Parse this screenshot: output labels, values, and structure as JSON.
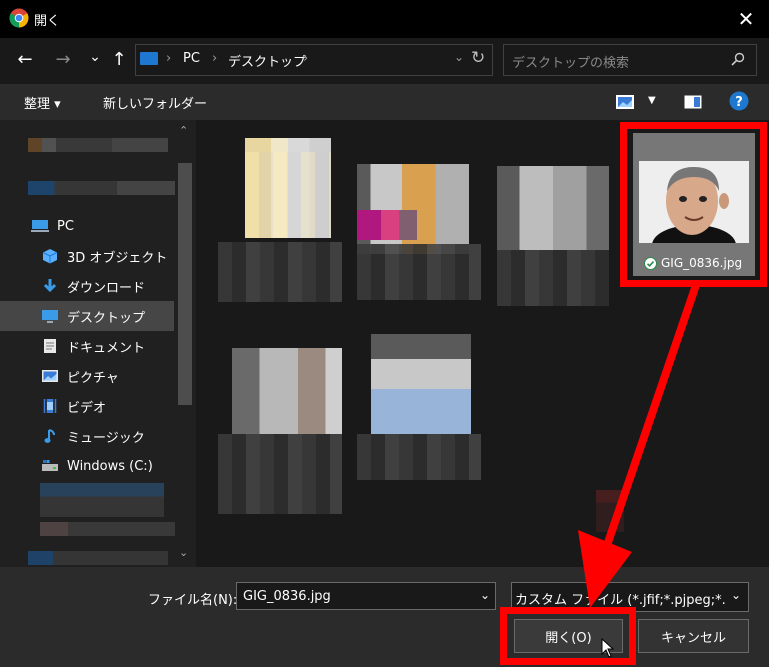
{
  "window": {
    "title": "開く",
    "close": "✕"
  },
  "nav": {
    "back": "←",
    "forward": "→",
    "recent": "⌄",
    "up": "↑",
    "breadcrumb": [
      "PC",
      "デスクトップ"
    ],
    "sep": "›",
    "refresh": "↻",
    "search_placeholder": "デスクトップの検索"
  },
  "toolbar": {
    "organize": "整理 ▾",
    "new_folder": "新しいフォルダー",
    "help": "?"
  },
  "sidebar": {
    "items": [
      {
        "label": "PC",
        "icon": "pc-icon"
      },
      {
        "label": "3D オブジェクト",
        "icon": "cube-icon"
      },
      {
        "label": "ダウンロード",
        "icon": "download-icon"
      },
      {
        "label": "デスクトップ",
        "icon": "desktop-icon",
        "selected": true
      },
      {
        "label": "ドキュメント",
        "icon": "document-icon"
      },
      {
        "label": "ピクチャ",
        "icon": "picture-icon"
      },
      {
        "label": "ビデオ",
        "icon": "video-icon"
      },
      {
        "label": "ミュージック",
        "icon": "music-icon"
      },
      {
        "label": "Windows (C:)",
        "icon": "drive-icon"
      }
    ]
  },
  "content": {
    "selected_file": "GIG_0836.jpg"
  },
  "footer": {
    "filename_label": "ファイル名(N):",
    "filename_value": "GIG_0836.jpg",
    "filter": "カスタム ファイル (*.jfif;*.pjpeg;*.jpe",
    "open": "開く(O)",
    "cancel": "キャンセル"
  },
  "colors": {
    "annotation": "#ff0000",
    "accent": "#1e78d0"
  }
}
